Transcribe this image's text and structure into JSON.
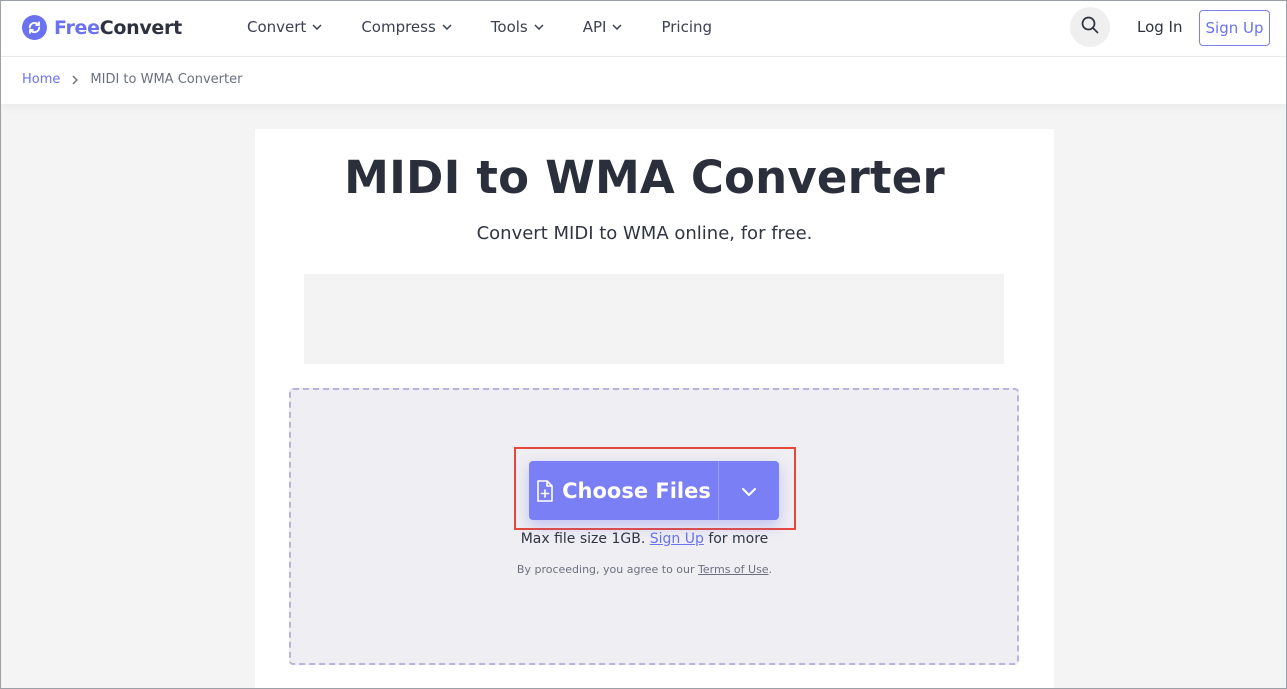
{
  "brand": {
    "name_part1": "Free",
    "name_part2": "Convert",
    "accent": "#6A72F0"
  },
  "nav": {
    "items": [
      {
        "label": "Convert",
        "has_dropdown": true
      },
      {
        "label": "Compress",
        "has_dropdown": true
      },
      {
        "label": "Tools",
        "has_dropdown": true
      },
      {
        "label": "API",
        "has_dropdown": true
      },
      {
        "label": "Pricing",
        "has_dropdown": false
      }
    ],
    "login_label": "Log In",
    "signup_label": "Sign Up",
    "search_icon": "search-icon"
  },
  "breadcrumb": {
    "home": "Home",
    "current": "MIDI to WMA Converter"
  },
  "main": {
    "title": "MIDI to WMA Converter",
    "subtitle": "Convert MIDI to WMA online, for free.",
    "choose_files_label": "Choose Files",
    "max_size_prefix": "Max file size 1GB.",
    "max_size_link": "Sign Up",
    "max_size_suffix": "for more",
    "terms_prefix": "By proceeding, you agree to our",
    "terms_link": "Terms of Use",
    "terms_suffix": "."
  },
  "colors": {
    "button": "#7A7FF5",
    "highlight": "#E5493D",
    "dropzone_border": "#B9B3DE"
  }
}
